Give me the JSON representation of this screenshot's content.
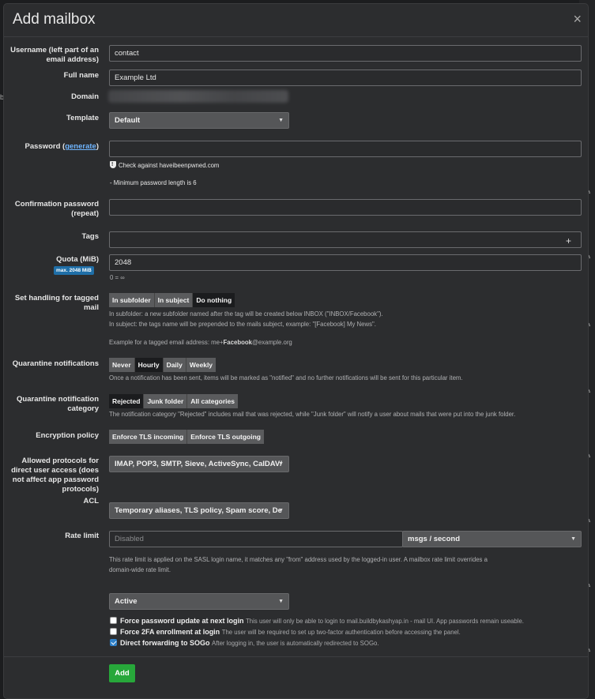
{
  "modal": {
    "title": "Add mailbox",
    "close_symbol": "×"
  },
  "fields": {
    "username": {
      "label": "Username (left part of an email address)",
      "value": "contact"
    },
    "full_name": {
      "label": "Full name",
      "value": "Example Ltd"
    },
    "domain": {
      "label": "Domain"
    },
    "template": {
      "label": "Template",
      "value": "Default"
    },
    "password": {
      "label_prefix": "Password (",
      "label_link": "generate",
      "label_suffix": ")",
      "value": "",
      "check_text": "Check against haveibeenpwned.com",
      "min_length_note": "- Minimum password length is 6"
    },
    "confirm_password": {
      "label": "Confirmation password (repeat)",
      "value": ""
    },
    "tags": {
      "label": "Tags",
      "value": "",
      "add_symbol": "+"
    },
    "quota": {
      "label": "Quota (MiB)",
      "badge": "max. 2048 MiB",
      "value": "2048",
      "note": "0 = ∞"
    },
    "tagged_mail": {
      "label": "Set handling for tagged mail",
      "options": [
        "In subfolder",
        "In subject",
        "Do nothing"
      ],
      "active": "Do nothing",
      "help1": "In subfolder: a new subfolder named after the tag will be created below INBOX (\"INBOX/Facebook\").",
      "help2": "In subject: the tags name will be prepended to the mails subject, example: \"[Facebook] My News\".",
      "example_prefix": "Example for a tagged email address: me+",
      "example_tag": "Facebook",
      "example_suffix": "@example.org"
    },
    "quarantine_notifications": {
      "label": "Quarantine notifications",
      "options": [
        "Never",
        "Hourly",
        "Daily",
        "Weekly"
      ],
      "active": "Hourly",
      "help": "Once a notification has been sent, items will be marked as \"notified\" and no further notifications will be sent for this particular item."
    },
    "quarantine_category": {
      "label": "Quarantine notification category",
      "options": [
        "Rejected",
        "Junk folder",
        "All categories"
      ],
      "active": "Rejected",
      "help": "The notification category \"Rejected\" includes mail that was rejected, while \"Junk folder\" will notify a user about mails that were put into the junk folder."
    },
    "encryption_policy": {
      "label": "Encryption policy",
      "options": [
        "Enforce TLS incoming",
        "Enforce TLS outgoing"
      ]
    },
    "protocols": {
      "label": "Allowed protocols for direct user access (does not affect app password protocols)",
      "value": "IMAP, POP3, SMTP, Sieve, ActiveSync, CalDAV/"
    },
    "acl": {
      "label": "ACL",
      "value": "Temporary aliases, TLS policy, Spam score, De"
    },
    "rate_limit": {
      "label": "Rate limit",
      "placeholder": "Disabled",
      "unit": "msgs / second",
      "help1": "This rate limit is applied on the SASL login name, it matches any \"from\" address used by the logged-in user. A mailbox rate limit overrides a",
      "help2": "domain-wide rate limit."
    },
    "status": {
      "value": "Active"
    },
    "checkboxes": [
      {
        "title": "Force password update at next login",
        "desc": "This user will only be able to login to mail.buildbykashyap.in - mail UI. App passwords remain useable.",
        "checked": false
      },
      {
        "title": "Force 2FA enrollment at login",
        "desc": "The user will be required to set up two-factor authentication before accessing the panel.",
        "checked": false
      },
      {
        "title": "Direct forwarding to SOGo",
        "desc": "After logging in, the user is automatically redirected to SOGo.",
        "checked": true
      }
    ]
  },
  "actions": {
    "add_label": "Add"
  },
  "colors": {
    "primary_button": "#27a73a",
    "badge": "#1f6fa8",
    "link": "#6fb5ff"
  }
}
